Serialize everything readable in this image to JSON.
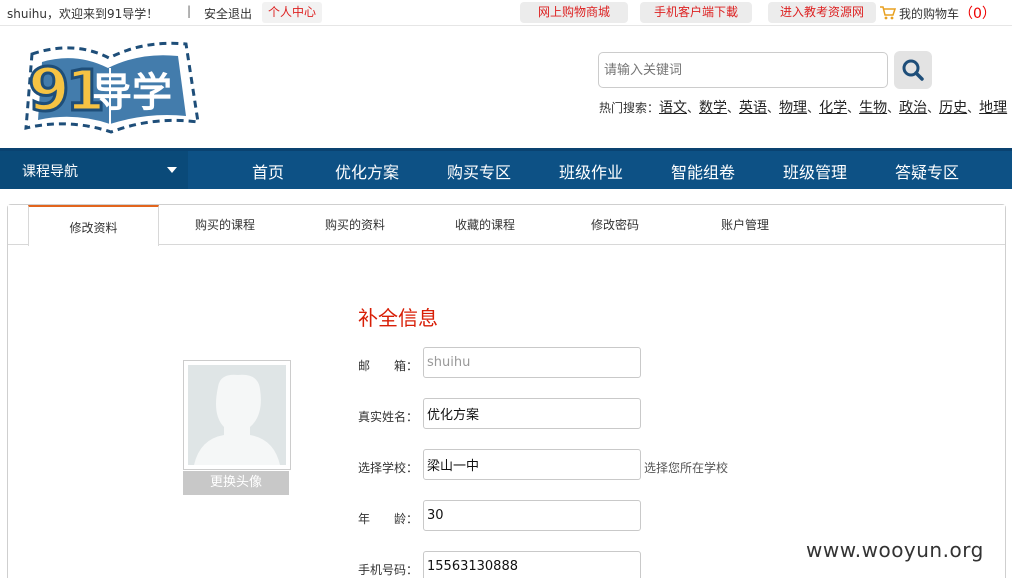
{
  "topbar": {
    "welcome": "shuihu，欢迎来到91导学！",
    "separator": "|",
    "logout": "安全退出",
    "user_center": "个人中心",
    "mall": "网上购物商城",
    "mobile_download": "手机客户端下載",
    "resource_net": "进入教考资源网",
    "cart_label": "我的购物车",
    "cart_count": "（0）"
  },
  "logo": {
    "text": "91导学"
  },
  "search": {
    "placeholder": "请输入关键词",
    "hot_label": "热门搜索：",
    "hot_items": [
      "语文",
      "数学",
      "英语",
      "物理",
      "化学",
      "生物",
      "政治",
      "历史",
      "地理"
    ]
  },
  "nav": {
    "course_nav": "课程导航",
    "items": [
      "首页",
      "优化方案",
      "购买专区",
      "班级作业",
      "智能组卷",
      "班级管理",
      "答疑专区"
    ]
  },
  "tabs": [
    "修改资料",
    "购买的课程",
    "购买的资料",
    "收藏的课程",
    "修改密码",
    "账户管理"
  ],
  "form": {
    "title": "补全信息",
    "avatar_button": "更换头像",
    "email_label": "邮　　箱：",
    "email_value": "shuihu",
    "realname_label": "真实姓名：",
    "realname_value": "优化方案",
    "school_label": "选择学校：",
    "school_value": "梁山一中",
    "school_hint": "选择您所在学校",
    "age_label": "年　　龄：",
    "age_value": "30",
    "phone_label": "手机号码：",
    "phone_value": "15563130888"
  },
  "watermark": "www.wooyun.org",
  "colors": {
    "nav_bg": "#0d5185",
    "accent_red": "#d81e06",
    "tab_active": "#e2651d"
  }
}
